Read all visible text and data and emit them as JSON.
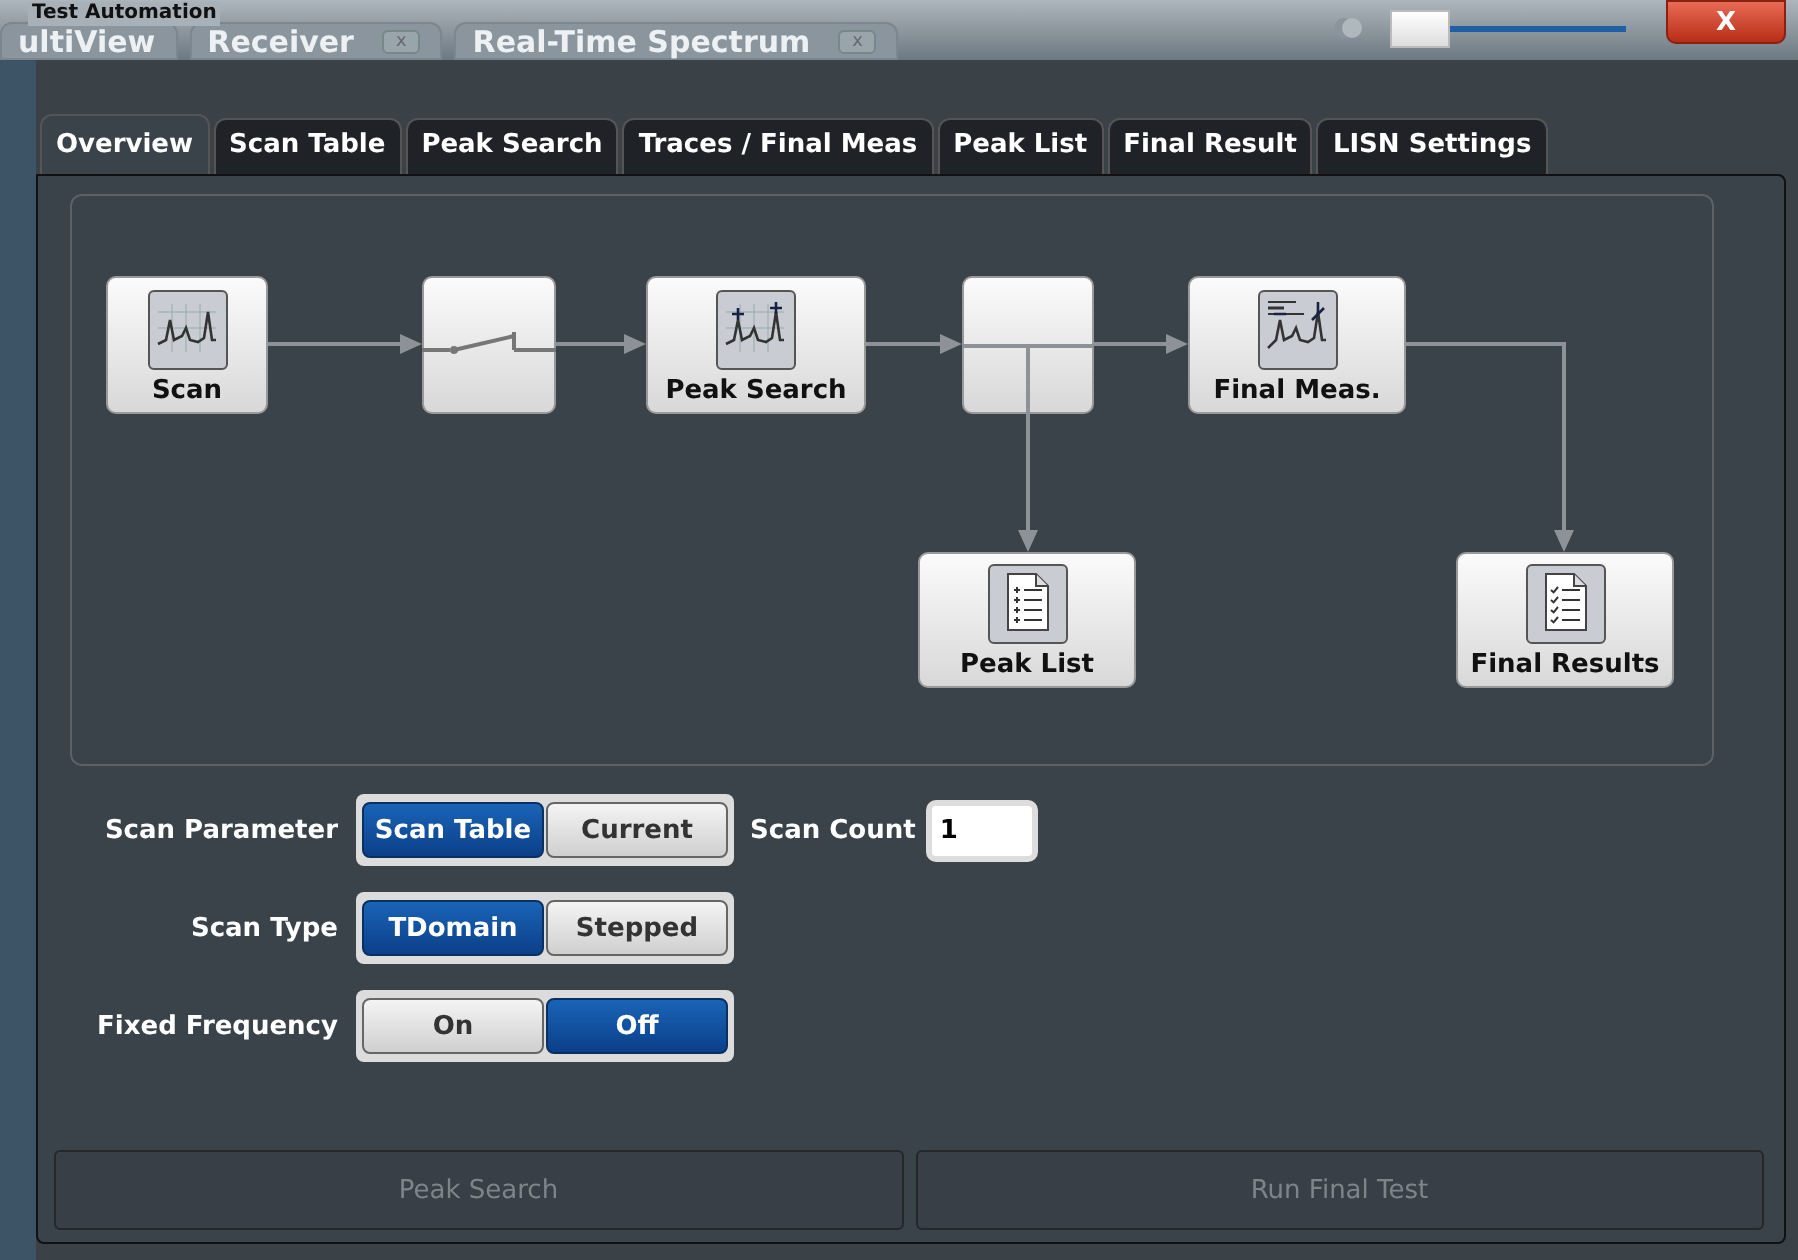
{
  "window": {
    "title": "Test Automation",
    "close": "X"
  },
  "background_tabs": [
    {
      "label": "ultiView"
    },
    {
      "label": "Receiver",
      "close": "x"
    },
    {
      "label": "Real-Time Spectrum",
      "close": "x"
    }
  ],
  "transparency_slider": {
    "level": 0.0
  },
  "tabs": [
    {
      "label": "Overview",
      "selected": true
    },
    {
      "label": "Scan Table",
      "selected": false
    },
    {
      "label": "Peak Search",
      "selected": false
    },
    {
      "label": "Traces / Final Meas",
      "selected": false
    },
    {
      "label": "Peak List",
      "selected": false
    },
    {
      "label": "Final Result",
      "selected": false
    },
    {
      "label": "LISN Settings",
      "selected": false
    }
  ],
  "diagram": {
    "nodes": [
      {
        "kind": "scan",
        "label": "Scan"
      },
      {
        "kind": "switch"
      },
      {
        "kind": "peak_search",
        "label": "Peak Search"
      },
      {
        "kind": "junction"
      },
      {
        "kind": "final_meas",
        "label": "Final Meas."
      },
      {
        "kind": "peak_list",
        "label": "Peak List"
      },
      {
        "kind": "final_results",
        "label": "Final Results"
      }
    ]
  },
  "settings": [
    {
      "label": "Scan Parameter",
      "options": [
        {
          "label": "Scan Table",
          "selected": true
        },
        {
          "label": "Current",
          "selected": false
        }
      ],
      "count": {
        "label": "Scan Count",
        "value": "1"
      }
    },
    {
      "label": "Scan Type",
      "options": [
        {
          "label": "TDomain",
          "selected": true
        },
        {
          "label": "Stepped",
          "selected": false
        }
      ]
    },
    {
      "label": "Fixed Frequency",
      "options": [
        {
          "label": "On",
          "selected": false
        },
        {
          "label": "Off",
          "selected": true
        }
      ]
    }
  ],
  "actions": [
    {
      "label": "Peak Search",
      "disabled": true
    },
    {
      "label": "Run Final Test",
      "disabled": true
    }
  ]
}
